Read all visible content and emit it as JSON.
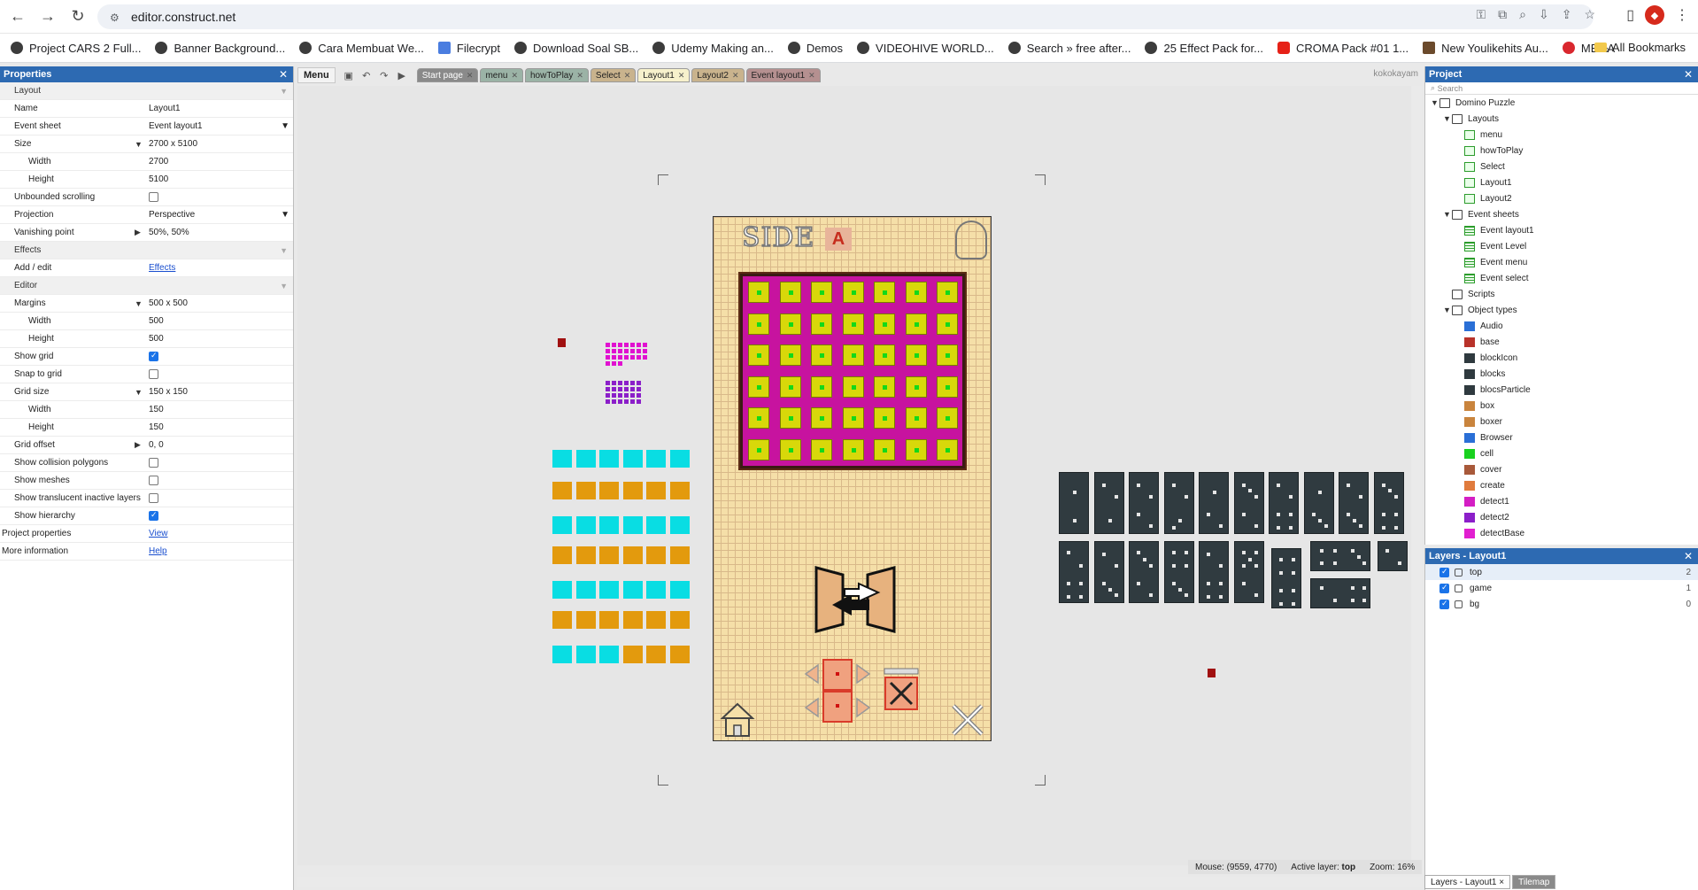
{
  "browser": {
    "url": "editor.construct.net",
    "bookmarks": [
      "Project CARS 2 Full...",
      "Banner Background...",
      "Cara Membuat We...",
      "Filecrypt",
      "Download Soal SB...",
      "Udemy Making an...",
      "Demos",
      "VIDEOHIVE WORLD...",
      "Search » free after...",
      "25 Effect Pack for...",
      "CROMA Pack #01 1...",
      "New Youlikehits Au...",
      "MEGA"
    ],
    "more": "»",
    "all_bookmarks": "All Bookmarks"
  },
  "properties": {
    "title": "Properties",
    "rows": [
      {
        "k": "Layout",
        "v": "",
        "type": "section"
      },
      {
        "k": "Name",
        "v": "Layout1"
      },
      {
        "k": "Event sheet",
        "v": "Event layout1",
        "type": "dropdown"
      },
      {
        "k": "Size",
        "v": "2700 x 5100",
        "type": "expand"
      },
      {
        "k": "Width",
        "v": "2700",
        "type": "sub"
      },
      {
        "k": "Height",
        "v": "5100",
        "type": "sub"
      },
      {
        "k": "Unbounded scrolling",
        "v": "",
        "type": "check",
        "checked": false
      },
      {
        "k": "Projection",
        "v": "Perspective",
        "type": "dropdown"
      },
      {
        "k": "Vanishing point",
        "v": "50%, 50%",
        "type": "expand-closed"
      },
      {
        "k": "Effects",
        "v": "",
        "type": "section"
      },
      {
        "k": "Add / edit",
        "v": "Effects",
        "type": "link"
      },
      {
        "k": "Editor",
        "v": "",
        "type": "section"
      },
      {
        "k": "Margins",
        "v": "500 x 500",
        "type": "expand"
      },
      {
        "k": "Width",
        "v": "500",
        "type": "sub"
      },
      {
        "k": "Height",
        "v": "500",
        "type": "sub"
      },
      {
        "k": "Show grid",
        "v": "",
        "type": "check",
        "checked": true
      },
      {
        "k": "Snap to grid",
        "v": "",
        "type": "check",
        "checked": false
      },
      {
        "k": "Grid size",
        "v": "150 x 150",
        "type": "expand"
      },
      {
        "k": "Width",
        "v": "150",
        "type": "sub"
      },
      {
        "k": "Height",
        "v": "150",
        "type": "sub"
      },
      {
        "k": "Grid offset",
        "v": "0, 0",
        "type": "expand-closed"
      },
      {
        "k": "Show collision polygons",
        "v": "",
        "type": "check",
        "checked": false
      },
      {
        "k": "Show meshes",
        "v": "",
        "type": "check",
        "checked": false
      },
      {
        "k": "Show translucent inactive layers",
        "v": "",
        "type": "check",
        "checked": false
      },
      {
        "k": "Show hierarchy",
        "v": "",
        "type": "check",
        "checked": true
      },
      {
        "k": "Project properties",
        "v": "View",
        "type": "link-plain"
      },
      {
        "k": "More information",
        "v": "Help",
        "type": "link-plain"
      }
    ]
  },
  "toolbar": {
    "menu": "Menu",
    "user": "kokokayam"
  },
  "tabs": [
    {
      "label": "Start page",
      "color": "#8a8a8a",
      "text": "#fff"
    },
    {
      "label": "menu",
      "color": "#9bb3a6",
      "text": "#222"
    },
    {
      "label": "howToPlay",
      "color": "#9bb3a6",
      "text": "#222"
    },
    {
      "label": "Select",
      "color": "#c9b38d",
      "text": "#222"
    },
    {
      "label": "Layout1",
      "color": "#f7f1cc",
      "text": "#222"
    },
    {
      "label": "Layout2",
      "color": "#c9b38d",
      "text": "#222"
    },
    {
      "label": "Event layout1",
      "color": "#b59090",
      "text": "#222"
    }
  ],
  "game": {
    "title": "SIDE",
    "badge": "A"
  },
  "status": {
    "mouse": "Mouse: (9559, 4770)",
    "active_label": "Active layer:",
    "active_value": "top",
    "zoom": "Zoom: 16%"
  },
  "project": {
    "title": "Project",
    "search_placeholder": "Search",
    "tree": [
      {
        "label": "Domino Puzzle",
        "level": 0,
        "icon": "folder",
        "twisty": "▼"
      },
      {
        "label": "Layouts",
        "level": 1,
        "icon": "folder",
        "twisty": "▼"
      },
      {
        "label": "menu",
        "level": 2,
        "icon": "layout"
      },
      {
        "label": "howToPlay",
        "level": 2,
        "icon": "layout"
      },
      {
        "label": "Select",
        "level": 2,
        "icon": "layout"
      },
      {
        "label": "Layout1",
        "level": 2,
        "icon": "layout"
      },
      {
        "label": "Layout2",
        "level": 2,
        "icon": "layout"
      },
      {
        "label": "Event sheets",
        "level": 1,
        "icon": "folder",
        "twisty": "▼"
      },
      {
        "label": "Event layout1",
        "level": 2,
        "icon": "sheet"
      },
      {
        "label": "Event Level",
        "level": 2,
        "icon": "sheet"
      },
      {
        "label": "Event menu",
        "level": 2,
        "icon": "sheet"
      },
      {
        "label": "Event select",
        "level": 2,
        "icon": "sheet"
      },
      {
        "label": "Scripts",
        "level": 1,
        "icon": "folder"
      },
      {
        "label": "Object types",
        "level": 1,
        "icon": "folder",
        "twisty": "▼"
      },
      {
        "label": "Audio",
        "level": 2,
        "icon": "obj",
        "color": "#2a6fd6"
      },
      {
        "label": "base",
        "level": 2,
        "icon": "obj",
        "color": "#b8322a"
      },
      {
        "label": "blockIcon",
        "level": 2,
        "icon": "obj",
        "color": "#2f3a3f"
      },
      {
        "label": "blocks",
        "level": 2,
        "icon": "obj",
        "color": "#2f3a3f"
      },
      {
        "label": "blocsParticle",
        "level": 2,
        "icon": "obj",
        "color": "#2f3a3f"
      },
      {
        "label": "box",
        "level": 2,
        "icon": "obj",
        "color": "#c9843d"
      },
      {
        "label": "boxer",
        "level": 2,
        "icon": "obj",
        "color": "#c9843d"
      },
      {
        "label": "Browser",
        "level": 2,
        "icon": "obj",
        "color": "#2a6fd6"
      },
      {
        "label": "cell",
        "level": 2,
        "icon": "obj",
        "color": "#19d11f"
      },
      {
        "label": "cover",
        "level": 2,
        "icon": "obj",
        "color": "#a8593a"
      },
      {
        "label": "create",
        "level": 2,
        "icon": "obj",
        "color": "#e07b3d"
      },
      {
        "label": "detect1",
        "level": 2,
        "icon": "obj",
        "color": "#d41ec4"
      },
      {
        "label": "detect2",
        "level": 2,
        "icon": "obj",
        "color": "#8b1fc9"
      },
      {
        "label": "detectBase",
        "level": 2,
        "icon": "obj",
        "color": "#e11fd0"
      }
    ]
  },
  "layers": {
    "title": "Layers - Layout1",
    "items": [
      {
        "name": "top",
        "index": "2"
      },
      {
        "name": "game",
        "index": "1"
      },
      {
        "name": "bg",
        "index": "0"
      }
    ]
  },
  "bottom_tabs": {
    "layers": "Layers - Layout1",
    "layers_close": "×",
    "tilemap": "Tilemap"
  },
  "close_glyph": "✕"
}
